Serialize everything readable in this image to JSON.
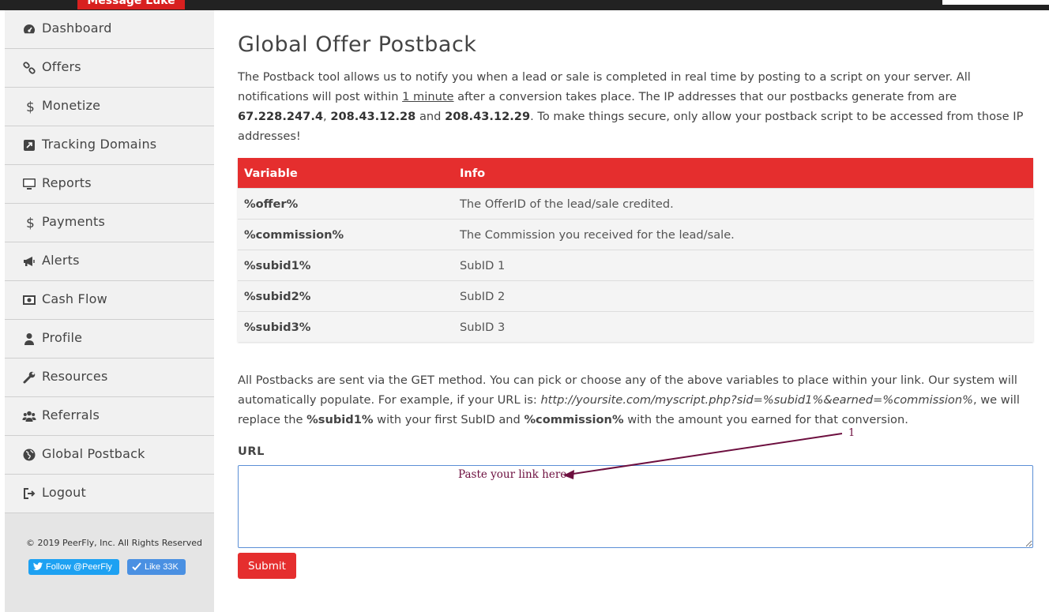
{
  "topbar": {
    "message_button": "Message Luke"
  },
  "sidebar": {
    "items": [
      {
        "label": "Dashboard",
        "icon": "dashboard-icon"
      },
      {
        "label": "Offers",
        "icon": "link-icon"
      },
      {
        "label": "Monetize",
        "icon": "dollar-icon"
      },
      {
        "label": "Tracking Domains",
        "icon": "external-link-icon"
      },
      {
        "label": "Reports",
        "icon": "monitor-icon"
      },
      {
        "label": "Payments",
        "icon": "dollar-icon"
      },
      {
        "label": "Alerts",
        "icon": "bullhorn-icon"
      },
      {
        "label": "Cash Flow",
        "icon": "money-icon"
      },
      {
        "label": "Profile",
        "icon": "user-icon"
      },
      {
        "label": "Resources",
        "icon": "wrench-icon"
      },
      {
        "label": "Referrals",
        "icon": "users-icon"
      },
      {
        "label": "Global Postback",
        "icon": "globe-icon"
      },
      {
        "label": "Logout",
        "icon": "sign-out-icon"
      }
    ],
    "copyright": "© 2019 PeerFly, Inc. All Rights Reserved",
    "twitter_button": "Follow @PeerFly",
    "like_button": "Like 33K"
  },
  "page": {
    "title": "Global Offer Postback",
    "intro": {
      "p1": "The Postback tool allows us to notify you when a lead or sale is completed in real time by posting to a script on your server. All notifications will post within ",
      "u1": "1 minute",
      "p2": " after a conversion takes place. The IP addresses that our postbacks generate from are ",
      "ip1": "67.228.247.4",
      "p3": ", ",
      "ip2": "208.43.12.28",
      "p4": " and ",
      "ip3": "208.43.12.29",
      "p5": ". To make things secure, only allow your postback script to be accessed from those IP addresses!"
    },
    "table": {
      "headers": [
        "Variable",
        "Info"
      ],
      "rows": [
        [
          "%offer%",
          "The OfferID of the lead/sale credited."
        ],
        [
          "%commission%",
          "The Commission you received for the lead/sale."
        ],
        [
          "%subid1%",
          "SubID 1"
        ],
        [
          "%subid2%",
          "SubID 2"
        ],
        [
          "%subid3%",
          "SubID 3"
        ]
      ]
    },
    "note": {
      "p1": "All Postbacks are sent via the GET method. You can pick or choose any of the above variables to place within your link. Our system will automatically populate. For example, if your URL is: ",
      "example": "http://yoursite.com/myscript.php?sid=%subid1%&earned=%commission%",
      "p2": ", we will replace the ",
      "b1": "%subid1%",
      "p3": " with your first SubID and ",
      "b2": "%commission%",
      "p4": " with the amount you earned for that conversion."
    },
    "url_label": "URL",
    "url_value": "",
    "submit_label": "Submit"
  },
  "annotation": {
    "text": "Paste your link here",
    "number": "1",
    "color": "#6d0f3f"
  }
}
